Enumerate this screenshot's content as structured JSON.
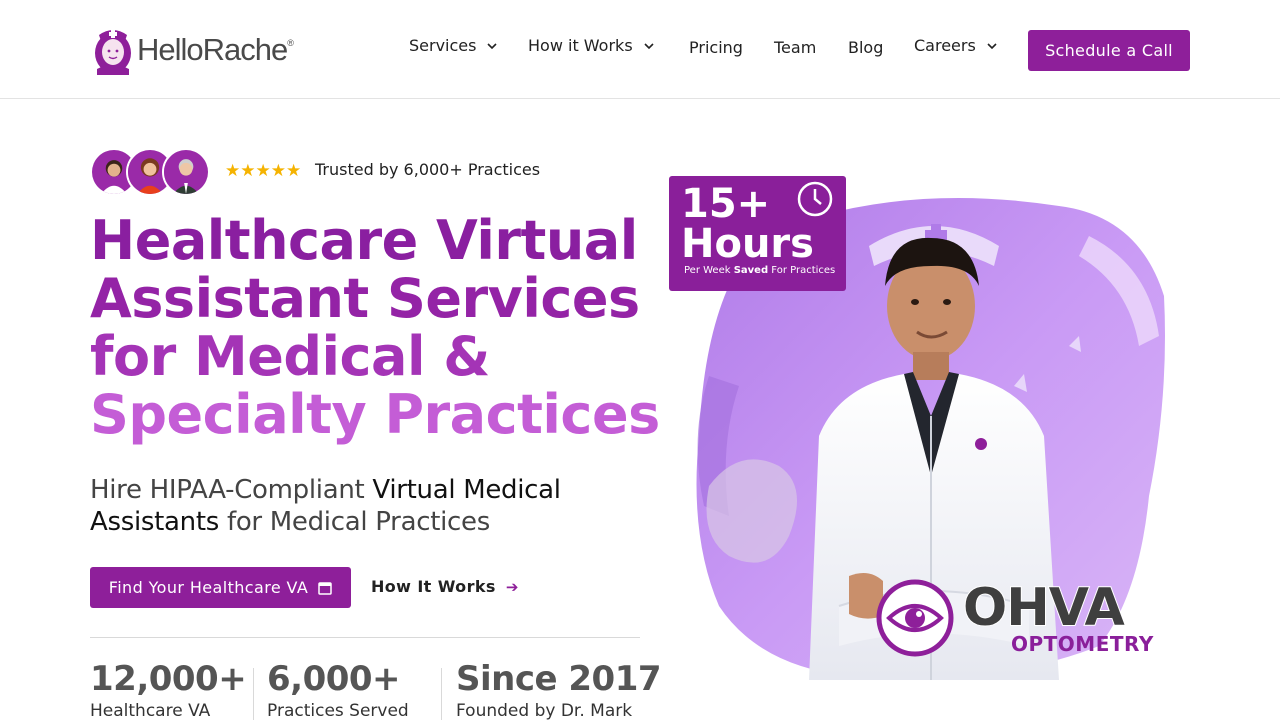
{
  "header": {
    "logo": {
      "text": "HelloRache",
      "trademark": "®"
    },
    "nav": [
      {
        "label": "Services",
        "has_dropdown": true
      },
      {
        "label": "How it Works",
        "has_dropdown": true
      },
      {
        "label": "Pricing",
        "has_dropdown": false
      },
      {
        "label": "Team",
        "has_dropdown": false
      },
      {
        "label": "Blog",
        "has_dropdown": false
      },
      {
        "label": "Careers",
        "has_dropdown": true
      }
    ],
    "cta_label": "Schedule a Call"
  },
  "hero": {
    "rating_stars": 5,
    "trusted_text": "Trusted by 6,000+ Practices",
    "headline_lines": [
      "Healthcare Virtual",
      "Assistant Services",
      "for Medical &",
      "Specialty Practices"
    ],
    "subhead": {
      "part1": "Hire HIPAA-Compliant ",
      "part2": "Virtual Medical",
      "part3": "Assistants",
      "part4": " for Medical Practices"
    },
    "primary_button": "Find Your Healthcare VA",
    "secondary_button": "How It Works",
    "stats": [
      {
        "value": "12,000+",
        "label": "Healthcare VA"
      },
      {
        "value": "6,000+",
        "label": "Practices Served"
      },
      {
        "value": "Since 2017",
        "label": "Founded by Dr. Mark"
      }
    ]
  },
  "promo": {
    "badge_line1": "15+",
    "badge_line2": "Hours",
    "badge_small_prefix": "Per Week ",
    "badge_small_bold": "Saved",
    "badge_small_suffix": " For Practices",
    "partner_title": "OHVA",
    "partner_subtitle": "OPTOMETRY"
  },
  "colors": {
    "brand": "#8e1f9a",
    "headline_gradient": [
      "#8a1fa0",
      "#9423a6",
      "#a434b6",
      "#c45dd6"
    ],
    "star": "#f5b301"
  }
}
